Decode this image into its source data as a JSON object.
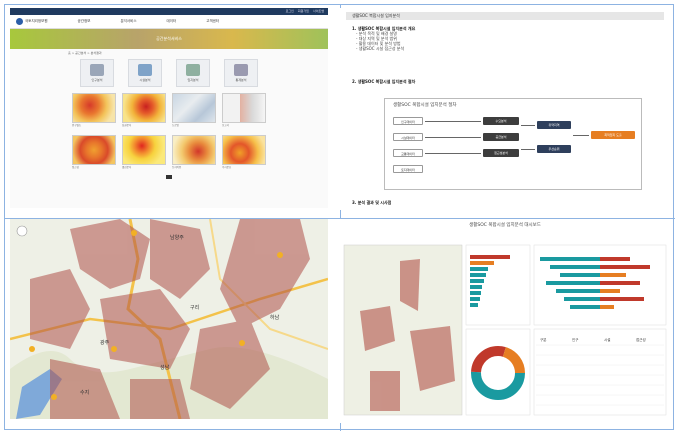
{
  "panel1": {
    "topbar_links": [
      "로그인",
      "회원가입",
      "사이트맵"
    ],
    "header_logo": "국토지리정보원",
    "nav_items": [
      "공간정보",
      "분석서비스",
      "데이터",
      "고객센터"
    ],
    "banner_title": "공간분석서비스",
    "breadcrumb": "홈 > 공간분석 > 분석결과",
    "icon_tiles": [
      "인구분석",
      "시설분석",
      "입지분석",
      "통계분석"
    ],
    "thumb_captions": [
      "인구밀도",
      "상권분석",
      "도로망",
      "보고서",
      "접근성",
      "열섬분석",
      "토지이용",
      "주거분포"
    ]
  },
  "panel2": {
    "title": "생활SOC 복합시설 입지분석",
    "section1": "1. 생활SOC 복합시설 입지분석 개요",
    "section1_lines": [
      "- 분석 목적 및 배경 설명",
      "- 대상 지역 및 분석 범위",
      "- 활용 데이터 및 분석 방법",
      "- 생활SOC 시설 접근성 분석"
    ],
    "section2": "2. 생활SOC 복합시설 입지분석 절차",
    "flow_title": "생활SOC 복합시설 입지분석 절차",
    "flow_inputs": [
      "인구데이터",
      "시설데이터",
      "교통데이터",
      "토지데이터"
    ],
    "flow_mid": [
      "수요분석",
      "공급분석",
      "접근성분석"
    ],
    "flow_mid2": [
      "취약지역",
      "우선순위"
    ],
    "flow_result": "최적입지 도출",
    "section3": "3. 분석 결과 및 시사점"
  },
  "panel3": {
    "place_labels": [
      "남양주",
      "구리",
      "하남",
      "광주",
      "성남",
      "수지"
    ]
  },
  "panel4": {
    "dashboard_title": "생활SOC 복합시설 입지분석 대시보드",
    "chart_titles": [
      "시설유형별 현황",
      "지역별 접근성 분포",
      "취약지역 비율",
      "읍면동별 분석결과"
    ],
    "table_headers": [
      "구분",
      "인구",
      "시설",
      "접근성"
    ]
  },
  "colors": {
    "frame": "#8db3e2",
    "hot": "#c0392b",
    "warm": "#f39c12",
    "teal": "#1a9aa0",
    "result": "#e67e22"
  }
}
